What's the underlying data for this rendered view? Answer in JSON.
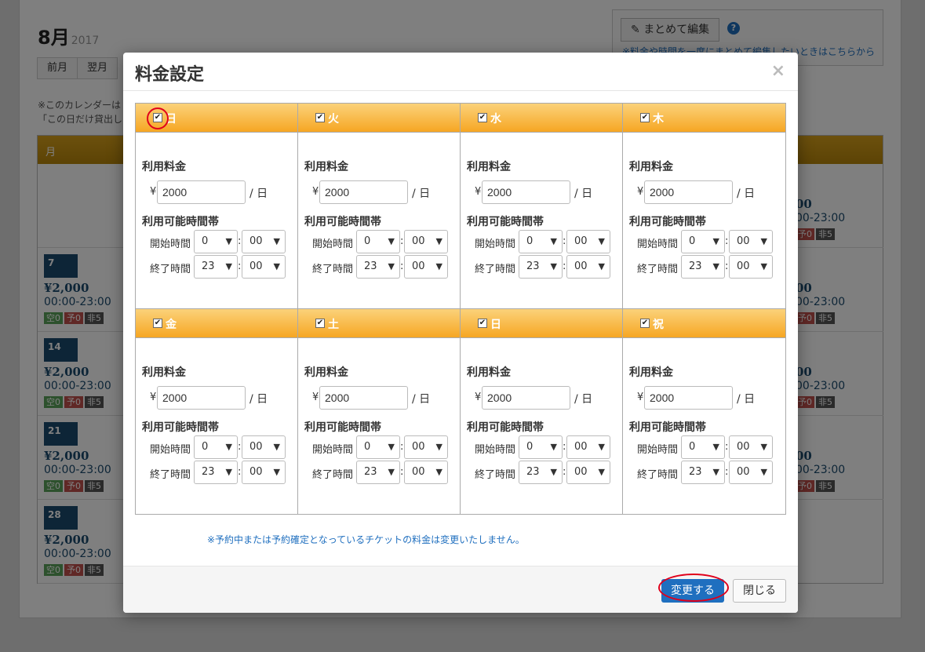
{
  "background": {
    "month": "8月",
    "year": "2017",
    "prev_label": "前月",
    "next_label": "翌月",
    "note_line1": "※このカレンダーは",
    "note_line2": "「この日だけ貸出し",
    "bulk_edit_label": "まとめて編集",
    "bulk_note": "※料金や時間を一度にまとめて編集したいときはこちらから",
    "calendar_header": "月",
    "weeks": [
      {
        "date": "7",
        "price": "¥2,000",
        "time": "00:00-23:00",
        "tag_a": "空0",
        "tag_b": "予0",
        "tag_c": "非5"
      },
      {
        "date": "14",
        "price": "¥2,000",
        "time": "00:00-23:00",
        "tag_a": "空0",
        "tag_b": "予0",
        "tag_c": "非5"
      },
      {
        "date": "21",
        "price": "¥2,000",
        "time": "00:00-23:00",
        "tag_a": "空0",
        "tag_b": "予0",
        "tag_c": "非5"
      },
      {
        "date": "28",
        "price": "¥2,000",
        "time": "00:00-23:00",
        "tag_a": "空0",
        "tag_b": "予0",
        "tag_c": "非5"
      }
    ],
    "right_column": [
      {
        "price": "00",
        "time": "00-23:00",
        "tag_b": "予0",
        "tag_c": "非5"
      },
      {
        "price": "00",
        "time": "00-23:00",
        "tag_b": "予0",
        "tag_c": "非5"
      },
      {
        "price": "00",
        "time": "00-23:00",
        "tag_b": "予0",
        "tag_c": "非5"
      },
      {
        "price": "00",
        "time": "00-23:00",
        "tag_b": "予0",
        "tag_c": "非5"
      }
    ]
  },
  "modal": {
    "title": "料金設定",
    "close_symbol": "×",
    "fee_label": "利用料金",
    "hours_label": "利用可能時間帯",
    "start_label": "開始時間",
    "end_label": "終了時間",
    "yen": "¥",
    "per_day": "/ 日",
    "colon": ":",
    "days": [
      {
        "label": "日",
        "fee": "2000",
        "start_h": "0",
        "start_m": "00",
        "end_h": "23",
        "end_m": "00"
      },
      {
        "label": "火",
        "fee": "2000",
        "start_h": "0",
        "start_m": "00",
        "end_h": "23",
        "end_m": "00"
      },
      {
        "label": "水",
        "fee": "2000",
        "start_h": "0",
        "start_m": "00",
        "end_h": "23",
        "end_m": "00"
      },
      {
        "label": "木",
        "fee": "2000",
        "start_h": "0",
        "start_m": "00",
        "end_h": "23",
        "end_m": "00"
      },
      {
        "label": "金",
        "fee": "2000",
        "start_h": "0",
        "start_m": "00",
        "end_h": "23",
        "end_m": "00"
      },
      {
        "label": "土",
        "fee": "2000",
        "start_h": "0",
        "start_m": "00",
        "end_h": "23",
        "end_m": "00"
      },
      {
        "label": "日",
        "fee": "2000",
        "start_h": "0",
        "start_m": "00",
        "end_h": "23",
        "end_m": "00"
      },
      {
        "label": "祝",
        "fee": "2000",
        "start_h": "0",
        "start_m": "00",
        "end_h": "23",
        "end_m": "00"
      }
    ],
    "footnote": "※予約中または予約確定となっているチケットの料金は変更いたしません。",
    "submit_label": "変更する",
    "close_label": "閉じる"
  },
  "colors": {
    "accent": "#1f6fbf",
    "header_orange": "#f6a623",
    "highlight_red": "#e0001b"
  }
}
